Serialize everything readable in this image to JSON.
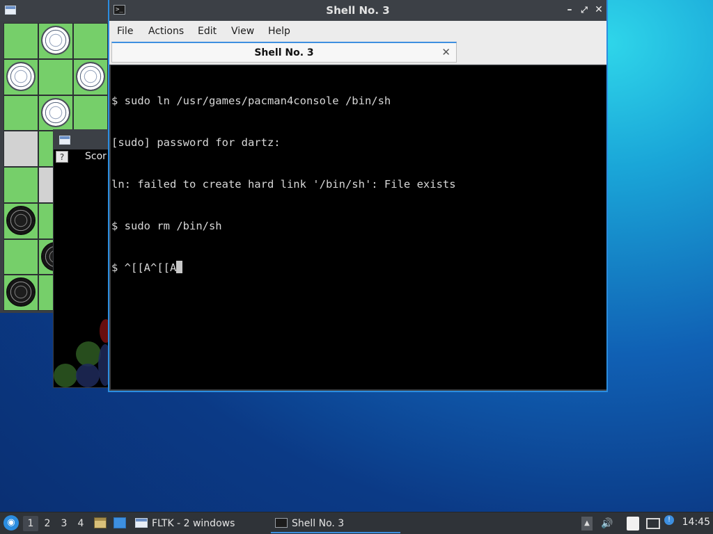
{
  "colors": {
    "accent": "#2b8de0",
    "terminal_bg": "#000000",
    "terminal_fg": "#d8d8d8",
    "titlebar_bg": "#3c4046",
    "board_green": "#76cf6a",
    "board_gray": "#d2d2d2"
  },
  "board_window": {
    "icon": "window-icon",
    "board": [
      [
        "green",
        "white",
        "green"
      ],
      [
        "white",
        "green",
        "white"
      ],
      [
        "green",
        "white",
        "green"
      ],
      [
        "gray",
        "green",
        "gray"
      ],
      [
        "green",
        "gray",
        "green"
      ],
      [
        "black",
        "green",
        "green"
      ],
      [
        "green",
        "black",
        "green"
      ],
      [
        "black",
        "green",
        "green"
      ]
    ]
  },
  "game_window": {
    "icon": "window-icon",
    "help_label": "?",
    "score_label": "Scor"
  },
  "terminal_window": {
    "title": "Shell No. 3",
    "icon": "terminal-icon",
    "controls": {
      "minimize": "–",
      "maximize": "⤢",
      "close": "✕"
    },
    "menu": [
      "File",
      "Actions",
      "Edit",
      "View",
      "Help"
    ],
    "tab": {
      "label": "Shell No. 3",
      "close": "✕"
    },
    "lines": [
      "$ sudo ln /usr/games/pacman4console /bin/sh",
      "[sudo] password for dartz:",
      "ln: failed to create hard link '/bin/sh': File exists",
      "$ sudo rm /bin/sh",
      "$ ^[[A^[[A"
    ]
  },
  "taskbar": {
    "start_icon": "lxqt-start-icon",
    "workspaces": [
      "1",
      "2",
      "3",
      "4"
    ],
    "active_workspace": "1",
    "quicklaunch": [
      "file-manager-icon",
      "show-desktop-icon"
    ],
    "tasks": [
      {
        "label": "FLTK - 2 windows",
        "icon": "window-icon",
        "active": false
      },
      {
        "label": "Shell No. 3",
        "icon": "terminal-icon",
        "active": true
      }
    ],
    "tray": [
      "tray-arrow-icon",
      "volume-icon",
      "clipboard-icon",
      "network-icon",
      "notification-icon"
    ],
    "clock": "14:45"
  }
}
